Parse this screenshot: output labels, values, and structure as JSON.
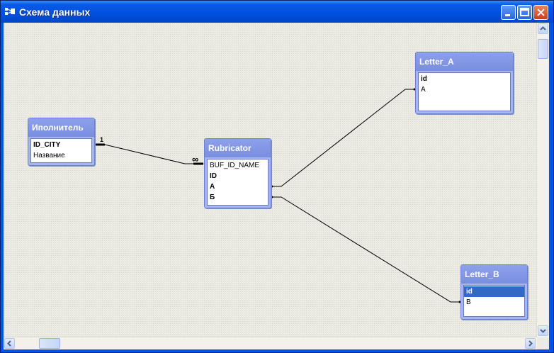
{
  "window": {
    "title": "Схема данных"
  },
  "tables": {
    "ispolnitel": {
      "name": "Иполнитель",
      "fields": [
        "ID_CITY",
        "Название"
      ]
    },
    "rubricator": {
      "name": "Rubricator",
      "fields": [
        "BUF_ID_NAME",
        "ID",
        "A",
        "Б"
      ]
    },
    "letter_a": {
      "name": "Letter_A",
      "fields": [
        "id",
        "A"
      ]
    },
    "letter_b": {
      "name": "Letter_B",
      "fields": [
        "id",
        "B"
      ]
    }
  },
  "relationship": {
    "one_label": "1",
    "many_label": "∞"
  },
  "colors": {
    "titlebar": "#0055e5",
    "table_header": "#8a9de8",
    "selection": "#316ac5"
  }
}
